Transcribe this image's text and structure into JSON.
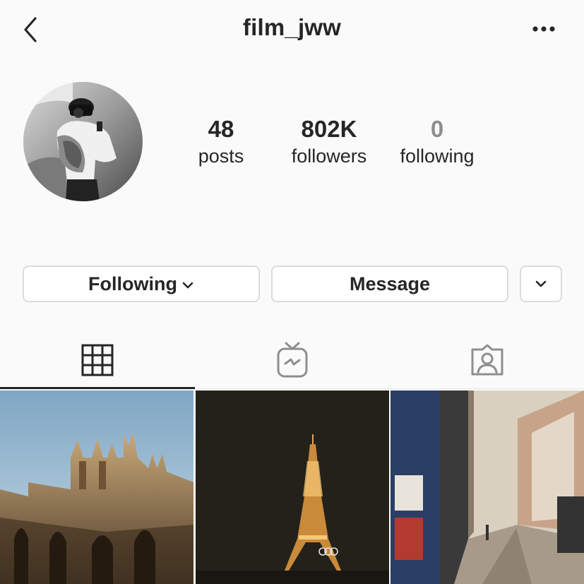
{
  "profile": {
    "username": "film_jww",
    "stats": [
      {
        "value": "48",
        "label": "posts"
      },
      {
        "value": "802K",
        "label": "followers"
      },
      {
        "value": "0",
        "label": "following"
      }
    ]
  },
  "actions": {
    "following_label": "Following",
    "message_label": "Message"
  },
  "tabs": [
    {
      "name": "posts-grid",
      "icon": "grid-icon",
      "active": true
    },
    {
      "name": "igtv",
      "icon": "igtv-icon",
      "active": false
    },
    {
      "name": "tagged",
      "icon": "tagged-user-icon",
      "active": false
    }
  ],
  "posts": [
    {
      "subject": "gothic-cathedral"
    },
    {
      "subject": "eiffel-tower-night"
    },
    {
      "subject": "paris-street"
    }
  ],
  "colors": {
    "text": "#262626",
    "muted": "#8e8e8e",
    "border": "#dbdbdb",
    "background": "#fafafa"
  }
}
